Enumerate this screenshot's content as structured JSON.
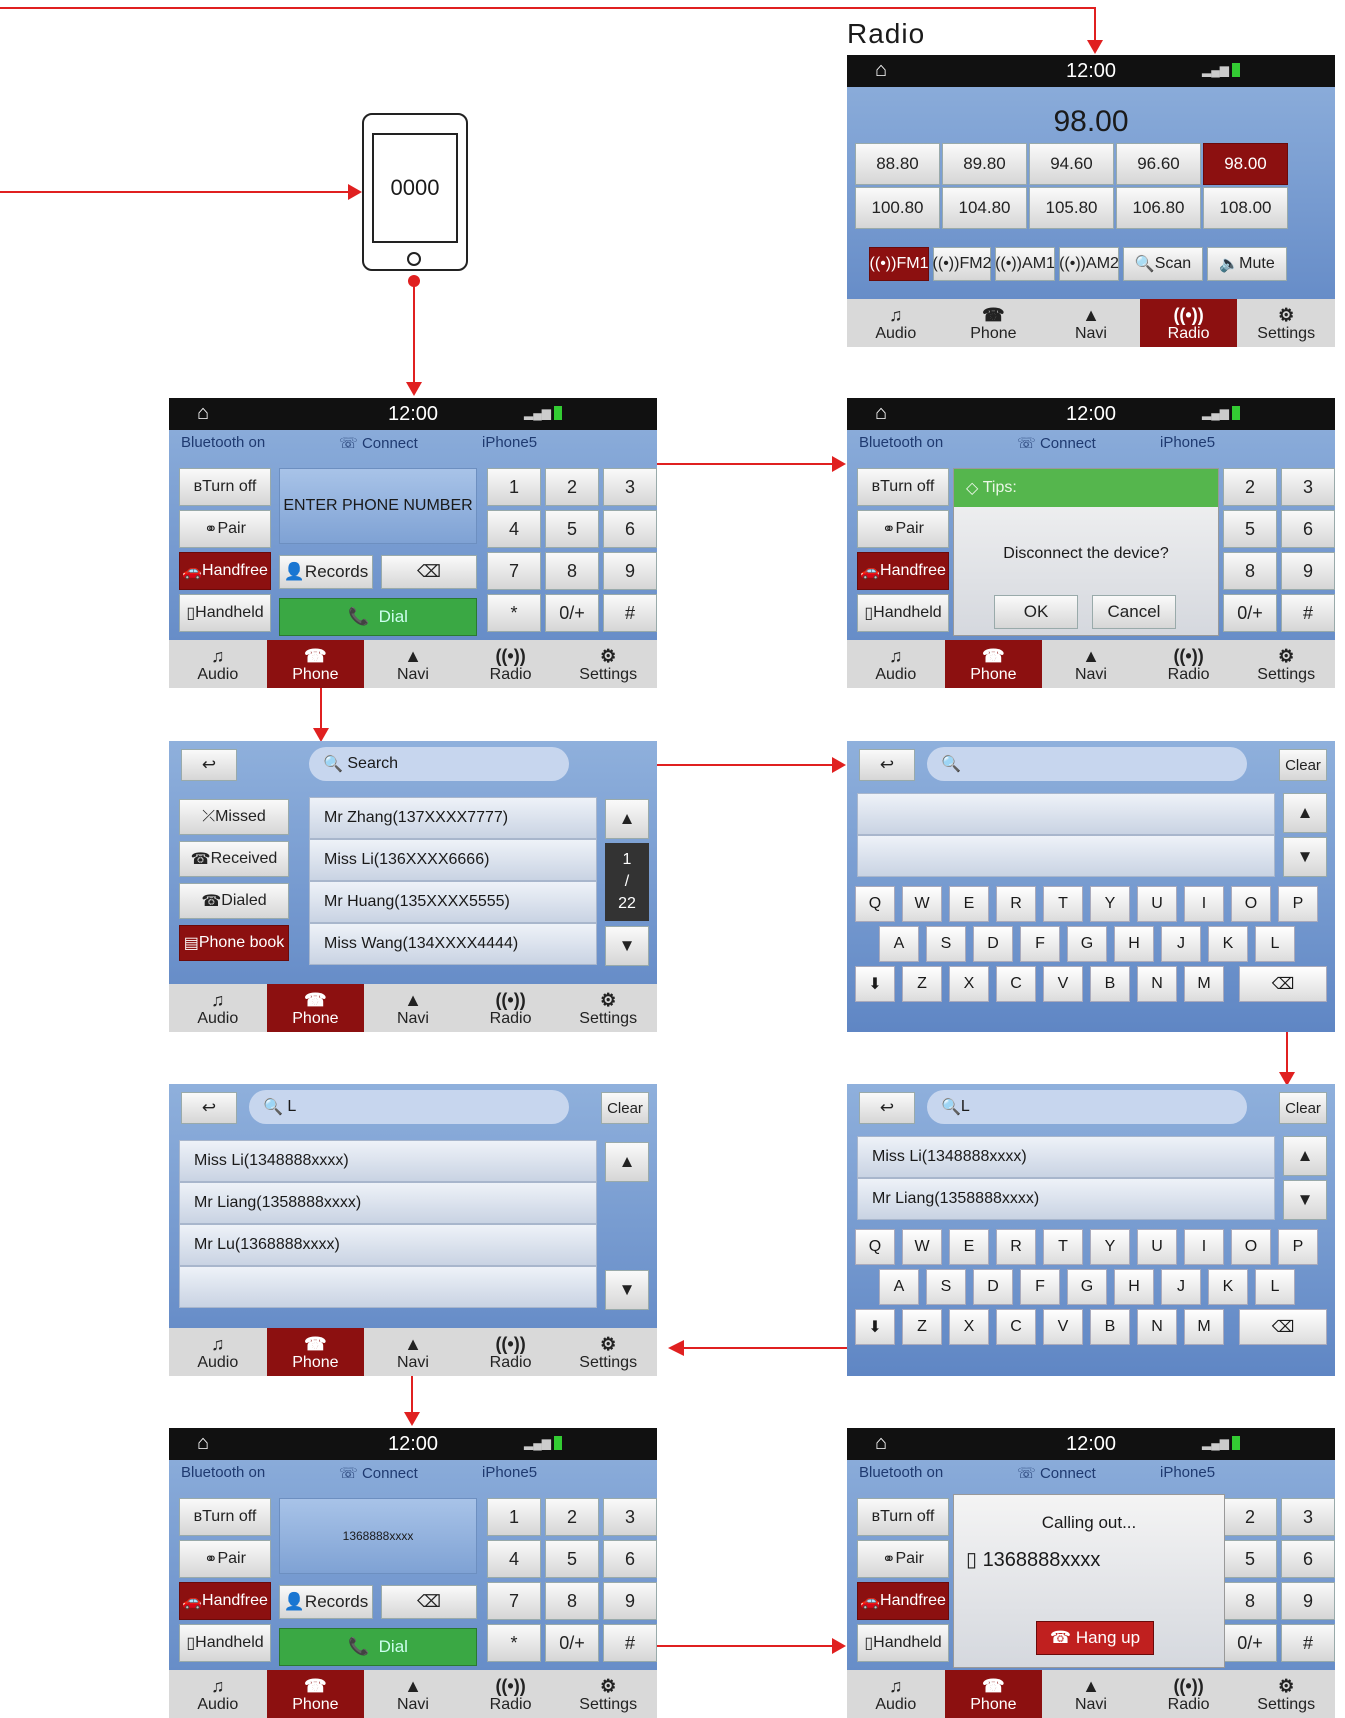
{
  "title": "Radio",
  "status": {
    "time": "12:00"
  },
  "nav": [
    "Audio",
    "Phone",
    "Navi",
    "Radio",
    "Settings"
  ],
  "phone_screen": {
    "pin": "0000"
  },
  "radio": {
    "freq": "98.00",
    "presets": [
      "88.80",
      "89.80",
      "94.60",
      "96.60",
      "98.00",
      "100.80",
      "104.80",
      "105.80",
      "106.80",
      "108.00"
    ],
    "bands": [
      "FM1",
      "FM2",
      "AM1",
      "AM2",
      "Scan",
      "Mute"
    ]
  },
  "bt": {
    "status": "Bluetooth on",
    "connect": "Connect",
    "device": "iPhone5"
  },
  "side": [
    "Turn off",
    "Pair",
    "Handfree",
    "Handheld"
  ],
  "keypad": [
    "1",
    "2",
    "3",
    "4",
    "5",
    "6",
    "7",
    "8",
    "9",
    "*",
    "0/+",
    "#"
  ],
  "dial": {
    "placeholder": "ENTER PHONE NUMBER",
    "records": "Records",
    "dial": "Dial",
    "number": "1368888xxxx"
  },
  "tips": {
    "title": "Tips:",
    "msg": "Disconnect the device?",
    "ok": "OK",
    "cancel": "Cancel"
  },
  "records": {
    "search": "Search",
    "tabs": [
      "Missed",
      "Received",
      "Dialed",
      "Phone book"
    ],
    "items": [
      "Mr Zhang(137XXXX7777)",
      "Miss Li(136XXXX6666)",
      "Mr Huang(135XXXX5555)",
      "Miss Wang(134XXXX4444)"
    ],
    "page": "1",
    "pagesep": "/",
    "pages": "22"
  },
  "kb": {
    "clear": "Clear",
    "query": "L",
    "row1": [
      "Q",
      "W",
      "E",
      "R",
      "T",
      "Y",
      "U",
      "I",
      "O",
      "P"
    ],
    "row2": [
      "A",
      "S",
      "D",
      "F",
      "G",
      "H",
      "J",
      "K",
      "L"
    ],
    "row3": [
      "Z",
      "X",
      "C",
      "V",
      "B",
      "N",
      "M"
    ]
  },
  "results": [
    "Miss Li(1348888xxxx)",
    "Mr Liang(1358888xxxx)",
    "Mr Lu(1368888xxxx)"
  ],
  "calling": {
    "msg": "Calling out...",
    "number": "1368888xxxx",
    "hangup": "Hang up"
  }
}
